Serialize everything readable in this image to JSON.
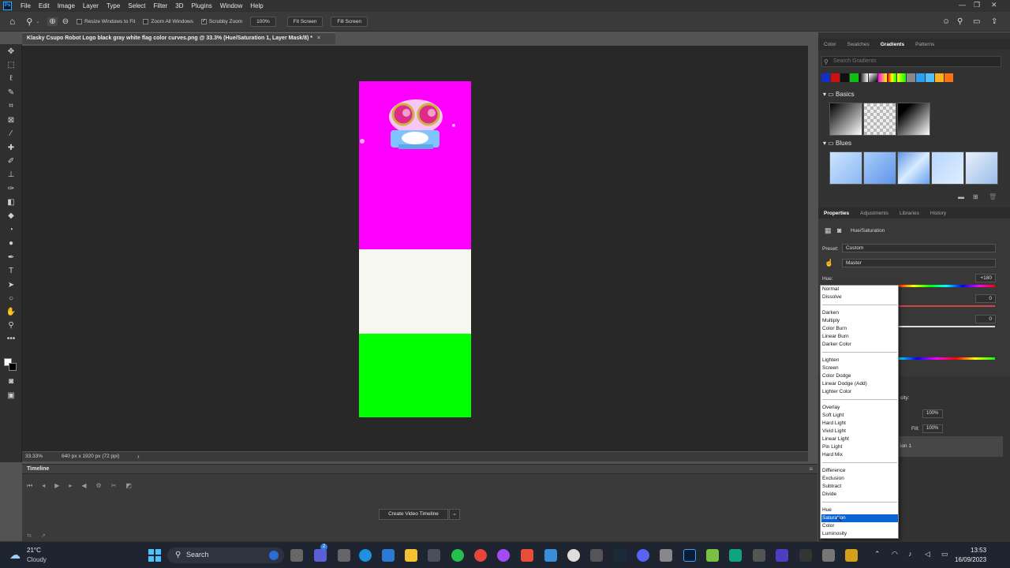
{
  "menubar": {
    "items": [
      "File",
      "Edit",
      "Image",
      "Layer",
      "Type",
      "Select",
      "Filter",
      "3D",
      "Plugins",
      "Window",
      "Help"
    ]
  },
  "options": {
    "resize_windows": "Resize Windows to Fit",
    "zoom_all": "Zoom All Windows",
    "scrubby_zoom": "Scrubby Zoom",
    "zoom_value": "100%",
    "fit_screen": "Fit Screen",
    "fill_screen": "Fill Screen"
  },
  "document": {
    "tab_title": "Klasky Csupo Robot Logo black gray white flag color curves.png @ 33.3% (Hue/Saturation 1, Layer Mask/8) *",
    "zoom": "33.33%",
    "size": "640 px x 1920 px (72 ppi)"
  },
  "timeline": {
    "title": "Timeline",
    "create_button": "Create Video Timeline"
  },
  "right_panel": {
    "tabs": [
      "Color",
      "Swatches",
      "Gradients",
      "Patterns"
    ],
    "active_tab": "Gradients",
    "search_placeholder": "Search Gradients",
    "groups": [
      "Basics",
      "Blues"
    ]
  },
  "properties": {
    "tabs": [
      "Properties",
      "Adjustments",
      "Libraries",
      "History"
    ],
    "title": "Hue/Saturation",
    "preset_label": "Preset:",
    "preset_value": "Custom",
    "channel": "Master",
    "hue_label": "Hue:",
    "hue_value": "+180",
    "sat_value": "0",
    "light_value": "0"
  },
  "layers": {
    "opacity_label": "city:",
    "opacity_value": "100%",
    "fill_label": "Fill:",
    "fill_value": "100%",
    "layer_name_fragment": "ion 1"
  },
  "blend_modes": {
    "groups": [
      [
        "Normal",
        "Dissolve"
      ],
      [
        "Darken",
        "Multiply",
        "Color Burn",
        "Linear Burn",
        "Darker Color"
      ],
      [
        "Lighten",
        "Screen",
        "Color Dodge",
        "Linear Dodge (Add)",
        "Lighter Color"
      ],
      [
        "Overlay",
        "Soft Light",
        "Hard Light",
        "Vivid Light",
        "Linear Light",
        "Pin Light",
        "Hard Mix"
      ],
      [
        "Difference",
        "Exclusion",
        "Subtract",
        "Divide"
      ],
      [
        "Hue",
        "Saturation",
        "Color",
        "Luminosity"
      ]
    ],
    "selected": "Saturation"
  },
  "taskbar": {
    "weather_temp": "21°C",
    "weather_desc": "Cloudy",
    "search": "Search",
    "time": "13:53",
    "date": "16/09/2023",
    "badge": "2"
  },
  "colors": {
    "magenta": "#ff00ff",
    "white": "#f7f7f2",
    "green": "#00ff00",
    "selection": "#0a64d4"
  }
}
